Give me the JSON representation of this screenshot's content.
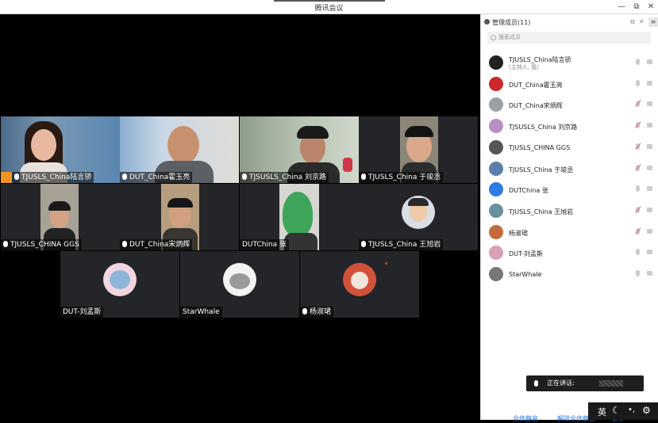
{
  "window": {
    "title": "腾讯会议",
    "controls": {
      "minimize": "—",
      "restore": "⧉",
      "close": "✕"
    }
  },
  "video_tiles": [
    {
      "name": "TJUSLS_China陆言骄",
      "host": true
    },
    {
      "name": "DUT_China霍玉亮"
    },
    {
      "name": "TJSUSLS_China 刘京路"
    },
    {
      "name": "TJUSLS_China 于竣丞"
    },
    {
      "name": "TJUSLS_CHINA GGS"
    },
    {
      "name": "DUT_China宋炳辉"
    },
    {
      "name": "DUTChina 张"
    },
    {
      "name": "TJUSLS_China 王旭岩"
    },
    {
      "name": "DUT-刘孟斯"
    },
    {
      "name": "StarWhale"
    },
    {
      "name": "杨淑珺"
    }
  ],
  "panel": {
    "title": "管理成员(11)",
    "search_placeholder": "搜索成员",
    "members": [
      {
        "name": "TJUSLS_China陆言骄",
        "sub": "(主持人, 我)",
        "muted": false,
        "avatar_color": "#222222"
      },
      {
        "name": "DUT_China霍玉亮",
        "muted": false,
        "avatar_color": "#cc2a2a"
      },
      {
        "name": "DUT_China宋炳辉",
        "muted": true,
        "avatar_color": "#9aa0a6"
      },
      {
        "name": "TJSUSLS_China 刘京路",
        "muted": true,
        "avatar_color": "#b98fc7"
      },
      {
        "name": "TJUSLS_CHINA GGS",
        "muted": true,
        "avatar_color": "#555555"
      },
      {
        "name": "TJUSLS_China 于竣丞",
        "muted": true,
        "avatar_color": "#5a7fa8"
      },
      {
        "name": "DUTChina 张",
        "muted": false,
        "avatar_color": "#2d7be5"
      },
      {
        "name": "TJUSLS_China 王旭岩",
        "muted": true,
        "avatar_color": "#6b8f9e"
      },
      {
        "name": "杨淑珺",
        "muted": true,
        "avatar_color": "#c46a3a"
      },
      {
        "name": "DUT-刘孟斯",
        "muted": false,
        "avatar_color": "#d9a0b8"
      },
      {
        "name": "StarWhale",
        "muted": false,
        "avatar_color": "#777777"
      }
    ],
    "speaking_label": "正在讲话:",
    "mute_all_label": "全体静音",
    "unmute_all_label": "解除全体静音",
    "more_label": "更多"
  },
  "taskbar": {
    "ime": "英"
  }
}
